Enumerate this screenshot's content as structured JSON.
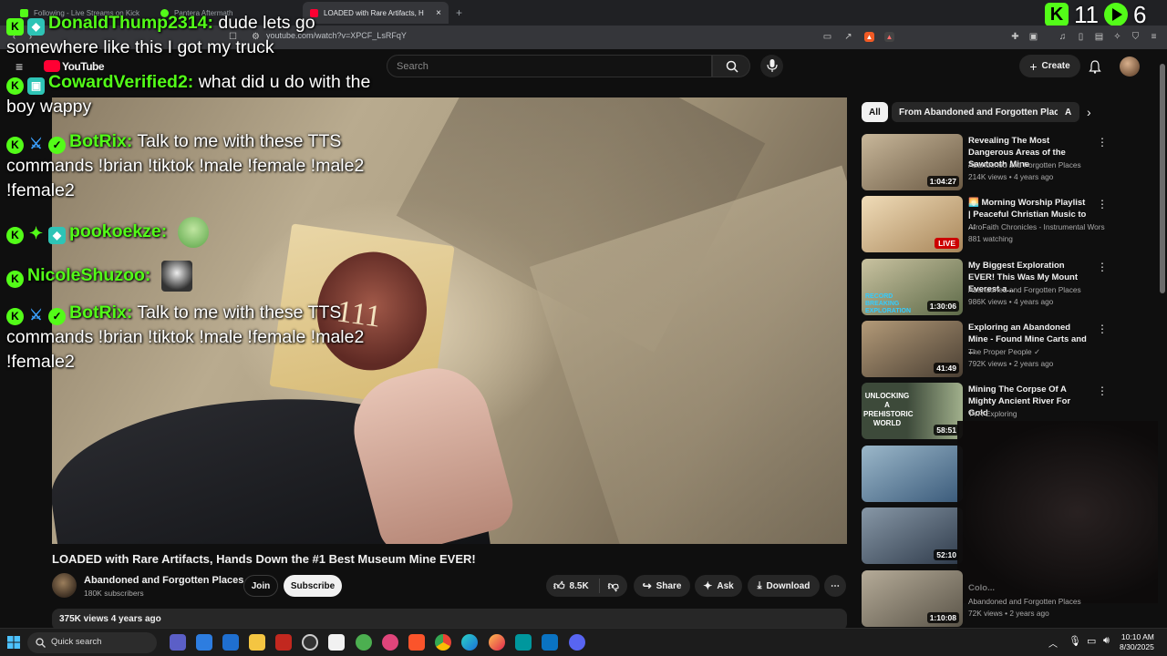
{
  "browser": {
    "tabs": [
      {
        "label": "Following - Live Streams on Kick",
        "color": "#53fc18"
      },
      {
        "label": "Pantera Aftermath",
        "color": "#53fc18"
      },
      {
        "label": "LOADED with Rare Artifacts, H",
        "color": "#ff0033"
      }
    ],
    "url": "youtube.com/watch?v=XPCF_LsRFqY"
  },
  "youtube": {
    "logo": "YouTube",
    "search_placeholder": "Search",
    "create_label": "Create"
  },
  "chat": [
    {
      "user": "DonaldThump2314:",
      "text": "dude lets go somewhere like this I got my truck",
      "user_color": "#53fc18"
    },
    {
      "user": "CowardVerified2:",
      "text": "what did u do with the boy wappy",
      "user_color": "#53fc18"
    },
    {
      "user": "BotRix:",
      "text": "Talk to me with these TTS commands !brian !tiktok !male !female !male2 !female2",
      "user_color": "#53fc18"
    },
    {
      "user": "pookoekze:",
      "text": "",
      "user_color": "#53fc18"
    },
    {
      "user": "NicoleShuzoo:",
      "text": "",
      "user_color": "#53fc18"
    },
    {
      "user": "BotRix:",
      "text": "Talk to me with these TTS commands !brian !tiktok !male !female !male2 !female2",
      "user_color": "#53fc18"
    }
  ],
  "kick_overlay": {
    "count1": "11",
    "count2": "6"
  },
  "video": {
    "title": "LOADED with Rare Artifacts, Hands Down the #1 Best Museum Mine EVER!",
    "channel": "Abandoned and Forgotten Places",
    "subscribers": "180K subscribers",
    "join_label": "Join",
    "subscribe_label": "Subscribe",
    "likes": "8.5K",
    "share_label": "Share",
    "ask_label": "Ask",
    "download_label": "Download",
    "views_line": "375K views  4 years ago",
    "card_number": "111"
  },
  "chips": [
    "All",
    "From Abandoned and Forgotten Places",
    "A"
  ],
  "recommendations": [
    {
      "title": "Revealing The Most Dangerous Areas of the Sawtooth Mine",
      "channel": "Abandoned and Forgotten Places",
      "meta": "214K views • 4 years ago",
      "duration": "1:04:27",
      "live": false,
      "c1": "#6b5a44",
      "c2": "#c8b79a"
    },
    {
      "title": "🌅 Morning Worship Playlist | Peaceful Christian Music to ...",
      "channel": "AfroFaith Chronicles - Instrumental Wors...",
      "meta": "881 watching",
      "duration": "LIVE",
      "live": true,
      "c1": "#a8865a",
      "c2": "#f0dcb8"
    },
    {
      "title": "My Biggest Exploration EVER! This Was My Mount Everest a...",
      "channel": "Abandoned and Forgotten Places",
      "meta": "986K views • 4 years ago",
      "duration": "1:30:06",
      "live": false,
      "c1": "#5d6a48",
      "c2": "#c9c2a0"
    },
    {
      "title": "Exploring an Abandoned Mine - Found Mine Carts and ...",
      "channel": "The Proper People ✓",
      "meta": "792K views • 2 years ago",
      "duration": "41:49",
      "live": false,
      "c1": "#4a3f33",
      "c2": "#b39a78"
    },
    {
      "title": "Mining The Corpse Of A Mighty Ancient River For Gold",
      "channel": "TVR Exploring",
      "meta": "",
      "duration": "58:51",
      "live": false,
      "c1": "#3d4a3a",
      "c2": "#a1b08c"
    },
    {
      "title": "",
      "channel": "",
      "meta": "",
      "duration": "",
      "live": false,
      "c1": "#3a5a7a",
      "c2": "#9bb7c9"
    },
    {
      "title": "",
      "channel": "",
      "meta": "",
      "duration": "52:10",
      "live": false,
      "c1": "#2e3a4a",
      "c2": "#8797a6"
    },
    {
      "title": "Colo...",
      "channel": "Abandoned and Forgotten Places",
      "meta": "72K views • 2 years ago",
      "duration": "1:10:08",
      "live": false,
      "c1": "#5a5448",
      "c2": "#b5ab98"
    }
  ],
  "overlay_text": {
    "unlock": "UNLOCKING A PREHISTORIC WORLD",
    "record": "RECORD BREAKING EXPLORATION"
  },
  "taskbar": {
    "search_label": "Quick search",
    "time": "10:10 AM",
    "date": "8/30/2025"
  }
}
